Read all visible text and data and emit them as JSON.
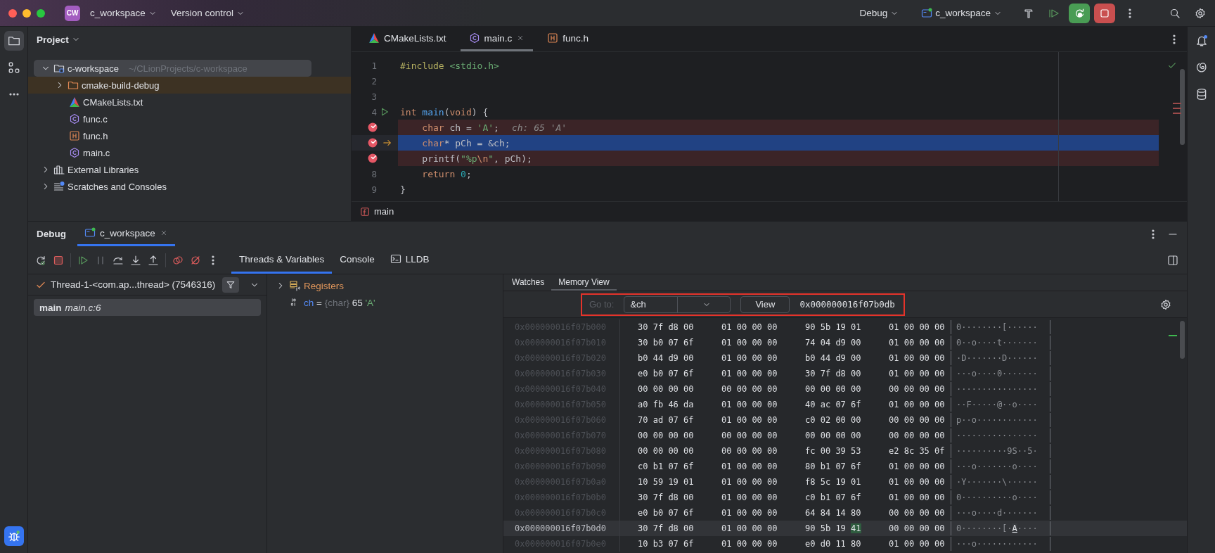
{
  "title_bar": {
    "project_badge": "CW",
    "project": "c_workspace",
    "vcs": "Version control",
    "run_configuration": "Debug",
    "target": "c_workspace"
  },
  "project_panel": {
    "title": "Project",
    "tree": [
      {
        "name": "c-workspace",
        "path": "~/CLionProjects/c-workspace",
        "kind": "module",
        "expanded": true,
        "selected": true,
        "children": [
          {
            "name": "cmake-build-debug",
            "kind": "excluded-folder",
            "expanded": false,
            "selected": false
          },
          {
            "name": "CMakeLists.txt",
            "kind": "cmake",
            "selected": false
          },
          {
            "name": "func.c",
            "kind": "c-source",
            "selected": false
          },
          {
            "name": "func.h",
            "kind": "c-header",
            "selected": false
          },
          {
            "name": "main.c",
            "kind": "c-source",
            "selected": false
          }
        ]
      },
      {
        "name": "External Libraries",
        "kind": "libraries",
        "expanded": false,
        "selected": false
      },
      {
        "name": "Scratches and Consoles",
        "kind": "scratches",
        "expanded": false,
        "selected": false
      }
    ]
  },
  "editor": {
    "tabs": [
      {
        "label": "CMakeLists.txt",
        "kind": "cmake",
        "selected": false
      },
      {
        "label": "main.c",
        "kind": "c-source",
        "selected": true
      },
      {
        "label": "func.h",
        "kind": "c-header",
        "selected": false
      }
    ],
    "lines": [
      {
        "number": "1",
        "breakpoint": false,
        "current": false,
        "runnable": false,
        "tokens": [
          {
            "text": "#include",
            "kind": "directive"
          },
          {
            "text": " <stdio.h>",
            "kind": "string"
          }
        ]
      },
      {
        "number": "2",
        "breakpoint": false,
        "current": false,
        "runnable": false
      },
      {
        "number": "3",
        "breakpoint": false,
        "current": false,
        "runnable": false
      },
      {
        "number": "4",
        "breakpoint": false,
        "current": false,
        "runnable": true,
        "tokens": [
          {
            "text": "int",
            "kind": "keyword"
          },
          {
            "text": " main",
            "kind": "function"
          },
          {
            "text": "(",
            "kind": "plain"
          },
          {
            "text": "void",
            "kind": "keyword"
          },
          {
            "text": ") {",
            "kind": "plain"
          }
        ]
      },
      {
        "breakpoint": true,
        "current": false,
        "runnable": false,
        "hint": "ch: 65 'A'",
        "tokens": [
          {
            "text": "    char",
            "kind": "keyword"
          },
          {
            "text": " ch = ",
            "kind": "plain"
          },
          {
            "text": "'A'",
            "kind": "string"
          },
          {
            "text": ";",
            "kind": "plain"
          }
        ]
      },
      {
        "breakpoint": true,
        "current": true,
        "runnable": false,
        "tokens": [
          {
            "text": "    char",
            "kind": "keyword"
          },
          {
            "text": "* pCh = &ch;",
            "kind": "plain"
          }
        ]
      },
      {
        "breakpoint": true,
        "current": false,
        "runnable": false,
        "tokens": [
          {
            "text": "    printf(",
            "kind": "plain"
          },
          {
            "text": "\"%p",
            "kind": "string"
          },
          {
            "text": "\\n",
            "kind": "escape"
          },
          {
            "text": "\"",
            "kind": "string"
          },
          {
            "text": ", pCh);",
            "kind": "plain"
          }
        ]
      },
      {
        "number": "8",
        "breakpoint": false,
        "current": false,
        "runnable": false,
        "tokens": [
          {
            "text": "    return",
            "kind": "keyword"
          },
          {
            "text": " 0",
            "kind": "number"
          },
          {
            "text": ";",
            "kind": "plain"
          }
        ]
      },
      {
        "number": "9",
        "breakpoint": false,
        "current": false,
        "runnable": false,
        "tokens": [
          {
            "text": "}",
            "kind": "plain"
          }
        ]
      }
    ],
    "breadcrumb": "main"
  },
  "debug_panel": {
    "title": "Debug",
    "session_tabs": [
      {
        "label": "c_workspace",
        "selected": true
      }
    ],
    "tabs": [
      {
        "label": "Threads & Variables",
        "kind": "variables",
        "selected": true
      },
      {
        "label": "Console",
        "kind": "console",
        "selected": false
      },
      {
        "label": "LLDB",
        "kind": "lldb",
        "selected": false
      }
    ],
    "thread": "Thread-1-<com.ap...thread> (7546316)",
    "frames": [
      {
        "function": "main",
        "location": "main.c:6",
        "selected": true
      }
    ],
    "variables": [
      {
        "kind": "group",
        "name": "Registers",
        "expanded": false
      },
      {
        "kind": "value",
        "name": "ch",
        "separator": "=",
        "type": "{char}",
        "value": "65",
        "char": "'A'"
      }
    ],
    "memory": {
      "tabs": [
        {
          "label": "Watches",
          "selected": false
        },
        {
          "label": "Memory View",
          "selected": true
        }
      ],
      "goto_label": "Go to:",
      "goto_value": "&ch",
      "view_button": "View",
      "address": "0x000000016f07b0db",
      "rows": [
        {
          "address": "0x000000016f07b000",
          "selected": false,
          "bytes": [
            "30",
            "7f",
            "d8",
            "00",
            "01",
            "00",
            "00",
            "00",
            "90",
            "5b",
            "19",
            "01",
            "01",
            "00",
            "00",
            "00"
          ],
          "ascii": "0········[······"
        },
        {
          "address": "0x000000016f07b010",
          "selected": false,
          "bytes": [
            "30",
            "b0",
            "07",
            "6f",
            "01",
            "00",
            "00",
            "00",
            "74",
            "04",
            "d9",
            "00",
            "01",
            "00",
            "00",
            "00"
          ],
          "ascii": "0··o····t·······"
        },
        {
          "address": "0x000000016f07b020",
          "selected": false,
          "bytes": [
            "b0",
            "44",
            "d9",
            "00",
            "01",
            "00",
            "00",
            "00",
            "b0",
            "44",
            "d9",
            "00",
            "01",
            "00",
            "00",
            "00"
          ],
          "ascii": "·D·······D······"
        },
        {
          "address": "0x000000016f07b030",
          "selected": false,
          "bytes": [
            "e0",
            "b0",
            "07",
            "6f",
            "01",
            "00",
            "00",
            "00",
            "30",
            "7f",
            "d8",
            "00",
            "01",
            "00",
            "00",
            "00"
          ],
          "ascii": "···o····0·······"
        },
        {
          "address": "0x000000016f07b040",
          "selected": false,
          "bytes": [
            "00",
            "00",
            "00",
            "00",
            "00",
            "00",
            "00",
            "00",
            "00",
            "00",
            "00",
            "00",
            "00",
            "00",
            "00",
            "00"
          ],
          "ascii": "················"
        },
        {
          "address": "0x000000016f07b050",
          "selected": false,
          "bytes": [
            "a0",
            "fb",
            "46",
            "da",
            "01",
            "00",
            "00",
            "00",
            "40",
            "ac",
            "07",
            "6f",
            "01",
            "00",
            "00",
            "00"
          ],
          "ascii": "··F·····@··o····"
        },
        {
          "address": "0x000000016f07b060",
          "selected": false,
          "bytes": [
            "70",
            "ad",
            "07",
            "6f",
            "01",
            "00",
            "00",
            "00",
            "c0",
            "02",
            "00",
            "00",
            "00",
            "00",
            "00",
            "00"
          ],
          "ascii": "p··o············"
        },
        {
          "address": "0x000000016f07b070",
          "selected": false,
          "bytes": [
            "00",
            "00",
            "00",
            "00",
            "00",
            "00",
            "00",
            "00",
            "00",
            "00",
            "00",
            "00",
            "00",
            "00",
            "00",
            "00"
          ],
          "ascii": "················"
        },
        {
          "address": "0x000000016f07b080",
          "selected": false,
          "bytes": [
            "00",
            "00",
            "00",
            "00",
            "00",
            "00",
            "00",
            "00",
            "fc",
            "00",
            "39",
            "53",
            "e2",
            "8c",
            "35",
            "0f"
          ],
          "ascii": "··········9S··5·"
        },
        {
          "address": "0x000000016f07b090",
          "selected": false,
          "bytes": [
            "c0",
            "b1",
            "07",
            "6f",
            "01",
            "00",
            "00",
            "00",
            "80",
            "b1",
            "07",
            "6f",
            "01",
            "00",
            "00",
            "00"
          ],
          "ascii": "···o·······o····"
        },
        {
          "address": "0x000000016f07b0a0",
          "selected": false,
          "bytes": [
            "10",
            "59",
            "19",
            "01",
            "01",
            "00",
            "00",
            "00",
            "f8",
            "5c",
            "19",
            "01",
            "01",
            "00",
            "00",
            "00"
          ],
          "ascii": "·Y·······\\······"
        },
        {
          "address": "0x000000016f07b0b0",
          "selected": false,
          "bytes": [
            "30",
            "7f",
            "d8",
            "00",
            "01",
            "00",
            "00",
            "00",
            "c0",
            "b1",
            "07",
            "6f",
            "01",
            "00",
            "00",
            "00"
          ],
          "ascii": "0··········o····"
        },
        {
          "address": "0x000000016f07b0c0",
          "selected": false,
          "bytes": [
            "e0",
            "b0",
            "07",
            "6f",
            "01",
            "00",
            "00",
            "00",
            "64",
            "84",
            "14",
            "80",
            "00",
            "00",
            "00",
            "00"
          ],
          "ascii": "···o····d·······"
        },
        {
          "address": "0x000000016f07b0d0",
          "selected": true,
          "bytes": [
            "30",
            "7f",
            "d8",
            "00",
            "01",
            "00",
            "00",
            "00",
            "90",
            "5b",
            "19",
            {
              "text": "41",
              "highlighted": true
            },
            "00",
            "00",
            "00",
            "00"
          ],
          "ascii": "0········[·A····"
        },
        {
          "address": "0x000000016f07b0e0",
          "selected": false,
          "bytes": [
            "10",
            "b3",
            "07",
            "6f",
            "01",
            "00",
            "00",
            "00",
            "e0",
            "d0",
            "11",
            "80",
            "01",
            "00",
            "00",
            "00"
          ],
          "ascii": "···o············"
        }
      ]
    }
  }
}
